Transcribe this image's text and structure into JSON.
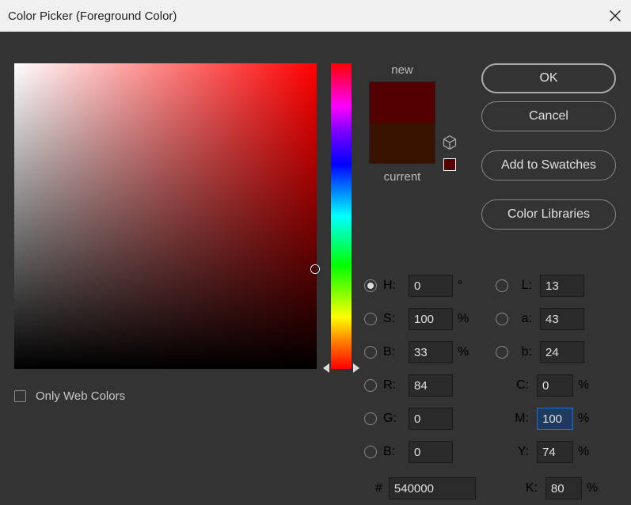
{
  "title": "Color Picker (Foreground Color)",
  "preview": {
    "new_label": "new",
    "current_label": "current",
    "new_color": "#540000",
    "current_color": "#3a1200"
  },
  "buttons": {
    "ok": "OK",
    "cancel": "Cancel",
    "add_swatches": "Add to Swatches",
    "libraries": "Color Libraries"
  },
  "web_only_label": "Only Web Colors",
  "hsv": {
    "h_label": "H:",
    "h": "0",
    "h_unit": "°",
    "s_label": "S:",
    "s": "100",
    "s_unit": "%",
    "b_label": "B:",
    "b": "33",
    "b_unit": "%"
  },
  "lab": {
    "l_label": "L:",
    "l": "13",
    "a_label": "a:",
    "a": "43",
    "b_label": "b:",
    "b": "24"
  },
  "rgb": {
    "r_label": "R:",
    "r": "84",
    "g_label": "G:",
    "g": "0",
    "b_label": "B:",
    "b": "0"
  },
  "cmyk": {
    "c_label": "C:",
    "c": "0",
    "m_label": "M:",
    "m": "100",
    "y_label": "Y:",
    "y": "74",
    "k_label": "K:",
    "k": "80",
    "unit": "%"
  },
  "hex": {
    "hash": "#",
    "value": "540000"
  },
  "active_model": "H"
}
